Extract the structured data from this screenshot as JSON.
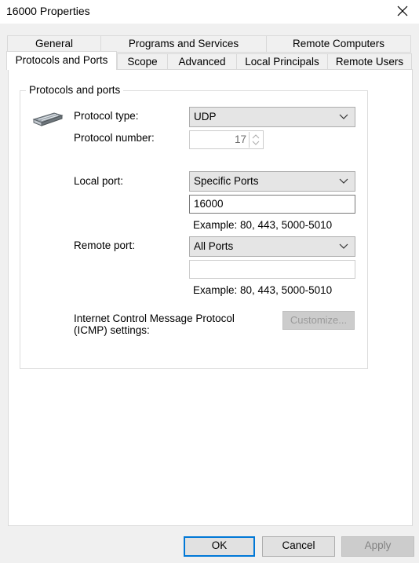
{
  "window": {
    "title": "16000 Properties"
  },
  "tabs": {
    "row1": [
      "General",
      "Programs and Services",
      "Remote Computers"
    ],
    "row2": [
      "Protocols and Ports",
      "Scope",
      "Advanced",
      "Local Principals",
      "Remote Users"
    ],
    "active": "Protocols and Ports"
  },
  "group": {
    "legend": "Protocols and ports",
    "protocol_type_label": "Protocol type:",
    "protocol_type_value": "UDP",
    "protocol_number_label": "Protocol number:",
    "protocol_number_value": "17",
    "local_port_label": "Local port:",
    "local_port_mode": "Specific Ports",
    "local_port_value": "16000",
    "local_example": "Example: 80, 443, 5000-5010",
    "remote_port_label": "Remote port:",
    "remote_port_mode": "All Ports",
    "remote_port_value": "",
    "remote_example": "Example: 80, 443, 5000-5010",
    "icmp_label_line1": "Internet Control Message Protocol",
    "icmp_label_line2": "(ICMP) settings:",
    "customize_label": "Customize..."
  },
  "footer": {
    "ok": "OK",
    "cancel": "Cancel",
    "apply": "Apply"
  },
  "icons": {
    "protocol": "network-plug-icon",
    "close": "close-icon"
  },
  "colors": {
    "default_button_border": "#0078d7",
    "panel_bg": "#ffffff",
    "window_bg": "#f0f0f0"
  }
}
